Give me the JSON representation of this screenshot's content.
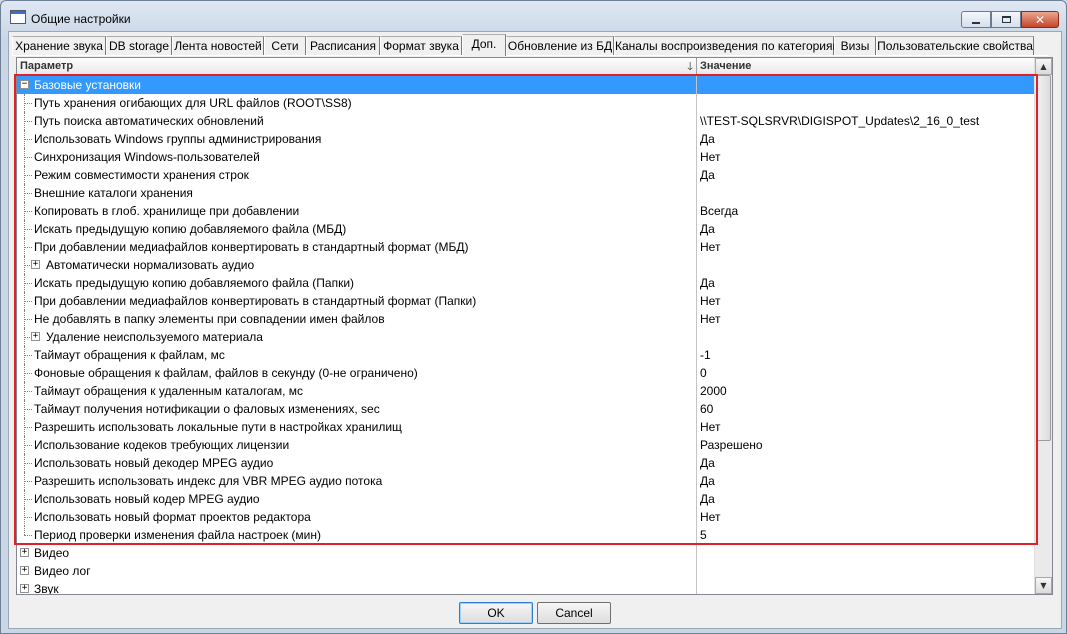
{
  "window": {
    "title": "Общие настройки"
  },
  "tabs": [
    {
      "label": "Хранение звука"
    },
    {
      "label": "DB storage"
    },
    {
      "label": "Лента новостей"
    },
    {
      "label": "Сети"
    },
    {
      "label": "Расписания"
    },
    {
      "label": "Формат звука"
    },
    {
      "label": "Доп."
    },
    {
      "label": "Обновление из БД"
    },
    {
      "label": "Каналы воспроизведения по категориям"
    },
    {
      "label": "Визы"
    },
    {
      "label": "Пользовательские свойства"
    }
  ],
  "active_tab": "Доп.",
  "grid": {
    "col_param": "Параметр",
    "col_value": "Значение",
    "rows": [
      {
        "param": "Базовые установки",
        "value": "",
        "level": 0,
        "expander": "−",
        "selected": true
      },
      {
        "param": "Путь хранения огибающих для URL файлов (ROOT\\SS8)",
        "value": "",
        "level": 1
      },
      {
        "param": "Путь поиска автоматических обновлений",
        "value": "\\\\TEST-SQLSRVR\\DIGISPOT_Updates\\2_16_0_test",
        "level": 1
      },
      {
        "param": "Использовать Windows группы администрирования",
        "value": "Да",
        "level": 1
      },
      {
        "param": "Синхронизация Windows-пользователей",
        "value": "Нет",
        "level": 1
      },
      {
        "param": "Режим совместимости хранения строк",
        "value": "Да",
        "level": 1
      },
      {
        "param": "Внешние каталоги хранения",
        "value": "",
        "level": 1
      },
      {
        "param": "Копировать в глоб. хранилище при добавлении",
        "value": "Всегда",
        "level": 1
      },
      {
        "param": "Искать предыдущую копию добавляемого файла (МБД)",
        "value": "Да",
        "level": 1
      },
      {
        "param": "При добавлении медиафайлов конвертировать в стандартный формат (МБД)",
        "value": "Нет",
        "level": 1
      },
      {
        "param": "Автоматически нормализовать аудио",
        "value": "",
        "level": 1,
        "expander": "+"
      },
      {
        "param": "Искать предыдущую копию добавляемого файла (Папки)",
        "value": "Да",
        "level": 1
      },
      {
        "param": "При добавлении медиафайлов конвертировать в стандартный формат (Папки)",
        "value": "Нет",
        "level": 1
      },
      {
        "param": "Не добавлять в папку элементы при совпадении имен файлов",
        "value": "Нет",
        "level": 1
      },
      {
        "param": "Удаление неиспользуемого материала",
        "value": "",
        "level": 1,
        "expander": "+"
      },
      {
        "param": "Таймаут обращения к файлам, мс",
        "value": "-1",
        "level": 1
      },
      {
        "param": "Фоновые обращения к файлам, файлов в секунду (0-не ограничено)",
        "value": "0",
        "level": 1
      },
      {
        "param": "Таймаут обращения к удаленным каталогам, мс",
        "value": "2000",
        "level": 1
      },
      {
        "param": "Таймаут получения нотификации о фаловых изменениях, sec",
        "value": "60",
        "level": 1
      },
      {
        "param": "Разрешить использовать локальные пути в настройках хранилищ",
        "value": "Нет",
        "level": 1
      },
      {
        "param": "Использование кодеков требующих лицензии",
        "value": "Разрешено",
        "level": 1
      },
      {
        "param": "Использовать новый декодер MPEG аудио",
        "value": "Да",
        "level": 1
      },
      {
        "param": "Разрешить использовать индекс для VBR MPEG аудио потока",
        "value": "Да",
        "level": 1
      },
      {
        "param": "Использовать новый кодер MPEG аудио",
        "value": "Да",
        "level": 1
      },
      {
        "param": "Использовать новый формат проектов редактора",
        "value": "Нет",
        "level": 1
      },
      {
        "param": "Период проверки изменения файла настроек (мин)",
        "value": "5",
        "level": 1,
        "last": true
      },
      {
        "param": "Видео",
        "value": "",
        "level": 0,
        "expander": "+"
      },
      {
        "param": "Видео лог",
        "value": "",
        "level": 0,
        "expander": "+"
      },
      {
        "param": "Звук",
        "value": "",
        "level": 0,
        "expander": "+"
      }
    ]
  },
  "buttons": {
    "ok": "OK",
    "cancel": "Cancel"
  },
  "colors": {
    "selection": "#3399ff",
    "highlight_box": "#e0202a"
  }
}
